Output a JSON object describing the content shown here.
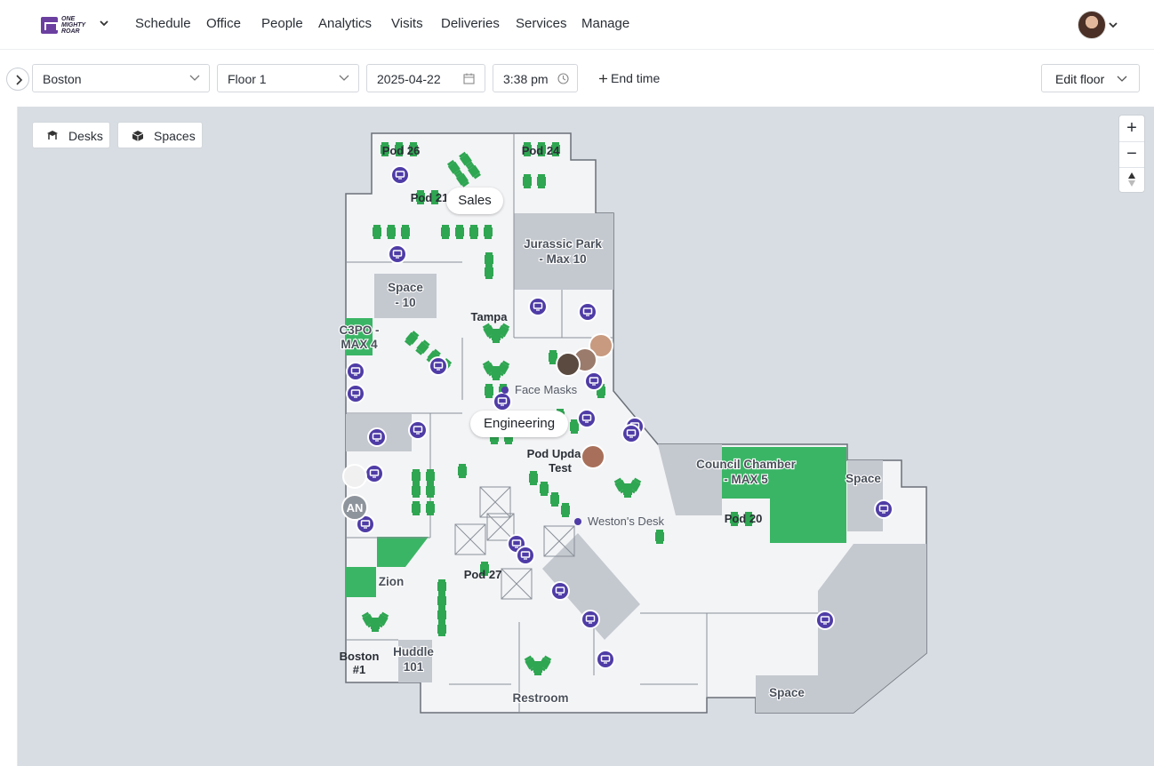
{
  "app": {
    "logo_text": "ONE MIGHTY ROAR",
    "nav": [
      "Schedule",
      "Office",
      "People",
      "Analytics",
      "Visits",
      "Deliveries",
      "Services",
      "Manage"
    ]
  },
  "toolbar": {
    "location": "Boston",
    "floor": "Floor 1",
    "date": "2025-04-22",
    "time": "3:38 pm",
    "end_time_label": "End time",
    "edit_floor_label": "Edit floor"
  },
  "map_controls": {
    "desks_label": "Desks",
    "spaces_label": "Spaces",
    "zoom_in": "+",
    "zoom_out": "−"
  },
  "map": {
    "neighborhoods": [
      "Sales",
      "Engineering"
    ],
    "rooms": [
      "Jurassic Park - Max 10",
      "Space - 10",
      "C3PO - MAX 4",
      "Council Chamber - MAX 5",
      "Space",
      "Zion",
      "Huddle 101",
      "Restroom",
      "Space"
    ],
    "room_lines": {
      "jurassic1": "Jurassic Park",
      "jurassic2": "- Max 10",
      "space10_1": "Space",
      "space10_2": "- 10",
      "c3po1": "C3PO -",
      "c3po2": "MAX 4",
      "council1": "Council Chamber",
      "council2": "- MAX 5",
      "space_right": "Space",
      "zion": "Zion",
      "huddle1": "Huddle",
      "huddle2": "101",
      "restroom": "Restroom",
      "space_bottom": "Space"
    },
    "pods": {
      "pod26": "Pod 26",
      "pod24": "Pod 24",
      "pod21": "Pod 21",
      "tampa": "Tampa",
      "podupd1": "Pod Upda",
      "podupd2": "Test",
      "pod20": "Pod 20",
      "pod27": "Pod 27",
      "boston1": "Boston",
      "boston2": "#1"
    },
    "pois": {
      "face_masks": "Face Masks",
      "westons_desk": "Weston's Desk"
    },
    "avatar_initials": "AN"
  },
  "colors": {
    "desk_green": "#2fa652",
    "room_green": "#3ab565",
    "poi_purple": "#4f3ca6",
    "map_bg": "#d8dde3",
    "room_grey": "#c4c8cf"
  }
}
